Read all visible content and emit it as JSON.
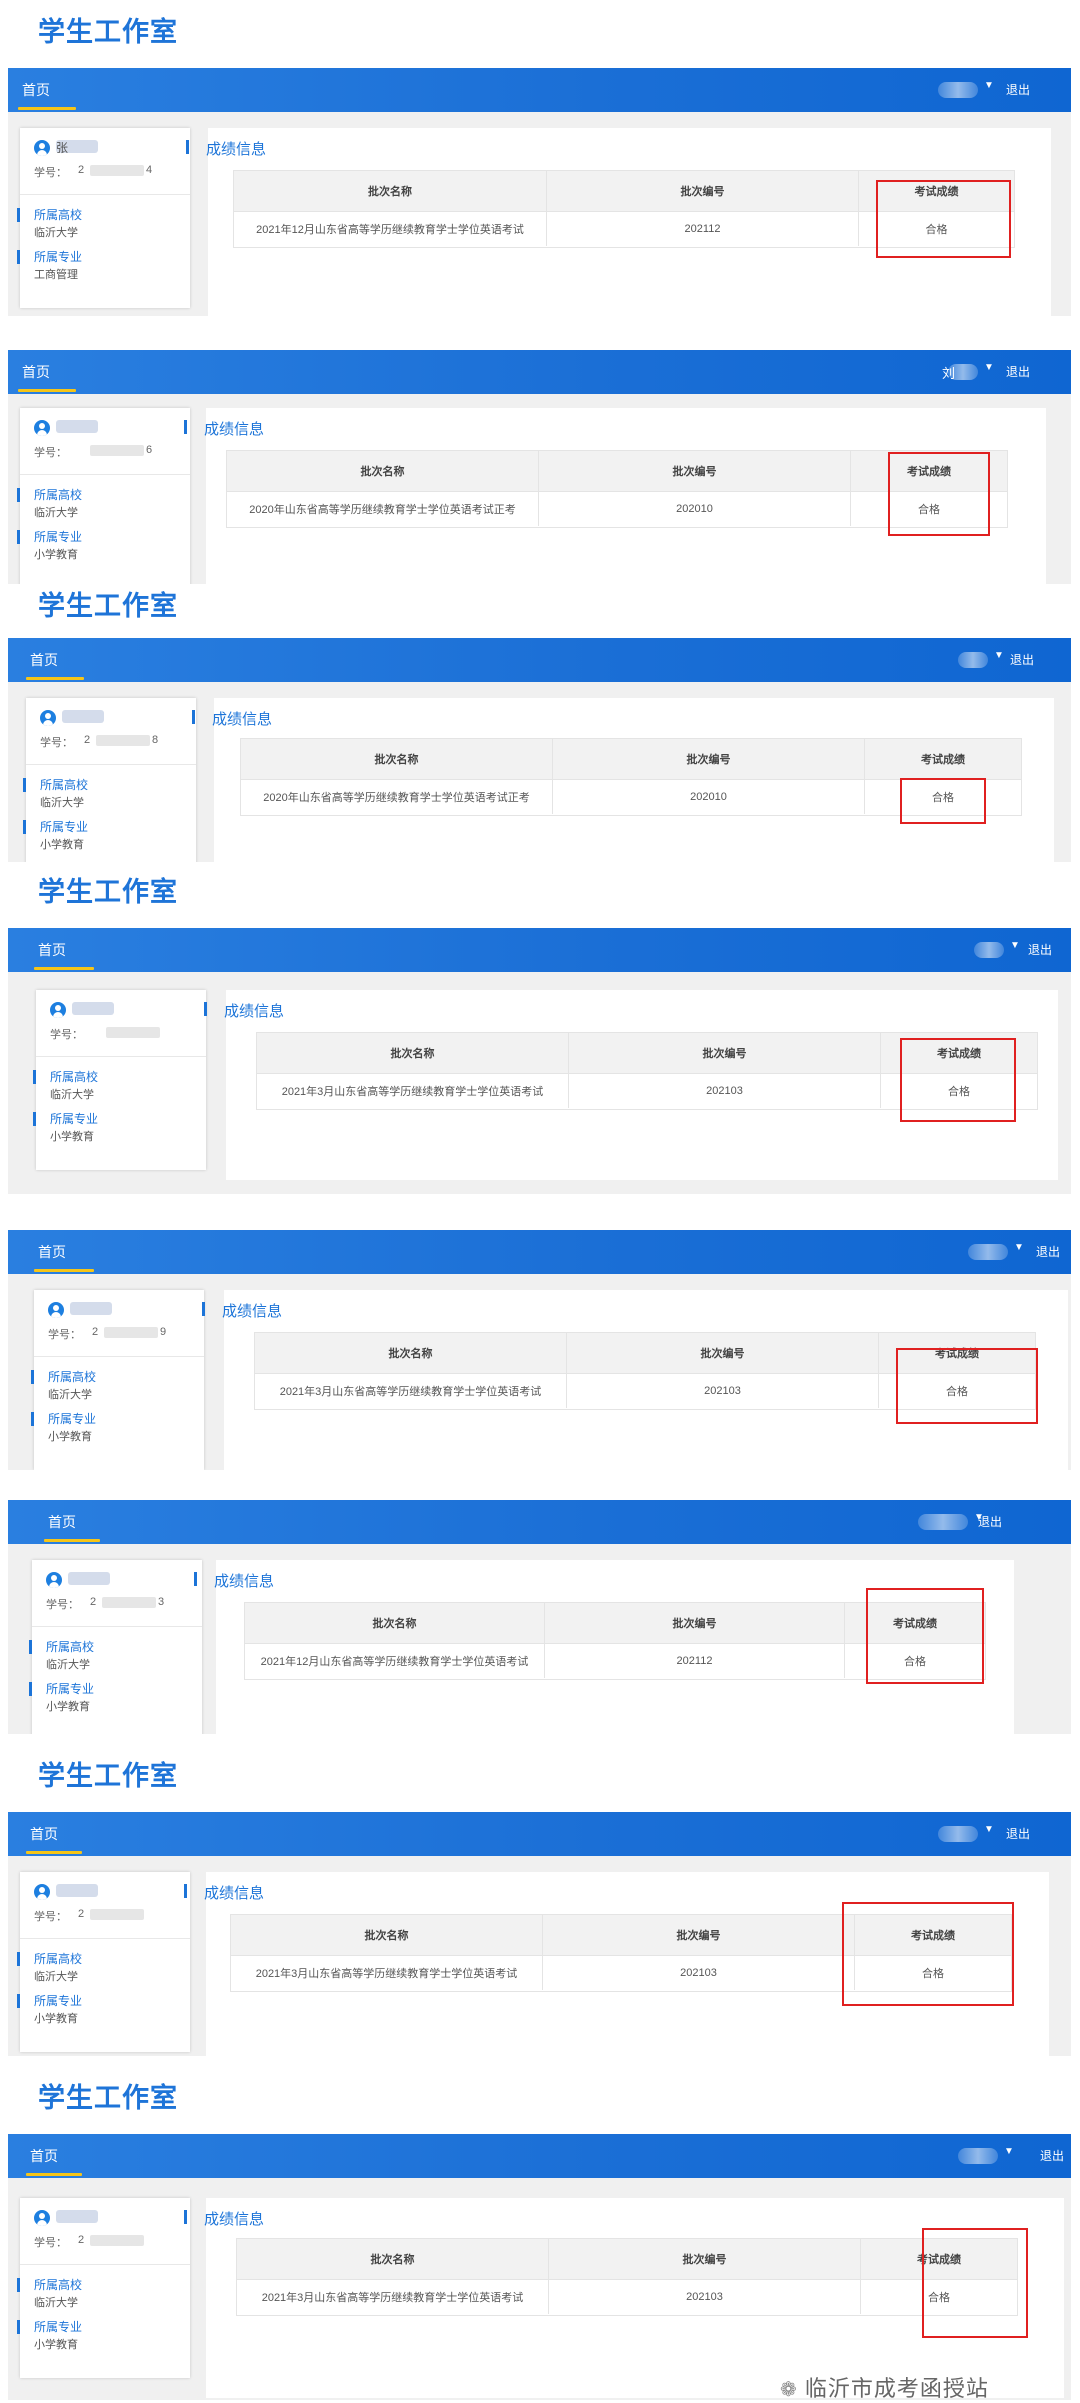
{
  "watermark": "学生工作室",
  "footer": {
    "text": "临沂市成考函授站",
    "icon": "wechat-icon"
  },
  "colors": {
    "topbar": "#1b6fd6",
    "accent": "#1c74d8",
    "highlight_box": "#e02020",
    "nav_underline": "#f5c518"
  },
  "common": {
    "nav_home": "首页",
    "logout": "退出",
    "section_title": "成绩信息",
    "student_no_label": "学号：",
    "school_label": "所属高校",
    "major_label": "所属专业",
    "col_batch_name": "批次名称",
    "col_batch_no": "批次编号",
    "col_score": "考试成绩"
  },
  "records": [
    {
      "name_char": "张",
      "user_char": "",
      "id_prefix": "2",
      "id_suffix": "4",
      "school": "临沂大学",
      "major": "工商管理",
      "batch_name": "2021年12月山东省高等学历继续教育学士学位英语考试",
      "batch_no": "202112",
      "score": "合格"
    },
    {
      "name_char": "",
      "user_char": "刘",
      "id_prefix": "",
      "id_suffix": "6",
      "school": "临沂大学",
      "major": "小学教育",
      "batch_name": "2020年山东省高等学历继续教育学士学位英语考试正考",
      "batch_no": "202010",
      "score": "合格"
    },
    {
      "name_char": "",
      "user_char": "",
      "id_prefix": "2",
      "id_suffix": "8",
      "school": "临沂大学",
      "major": "小学教育",
      "batch_name": "2020年山东省高等学历继续教育学士学位英语考试正考",
      "batch_no": "202010",
      "score": "合格"
    },
    {
      "name_char": "",
      "user_char": "",
      "id_prefix": "",
      "id_suffix": "",
      "school": "临沂大学",
      "major": "小学教育",
      "batch_name": "2021年3月山东省高等学历继续教育学士学位英语考试",
      "batch_no": "202103",
      "score": "合格"
    },
    {
      "name_char": "",
      "user_char": "",
      "id_prefix": "2",
      "id_suffix": "9",
      "school": "临沂大学",
      "major": "小学教育",
      "batch_name": "2021年3月山东省高等学历继续教育学士学位英语考试",
      "batch_no": "202103",
      "score": "合格"
    },
    {
      "name_char": "",
      "user_char": "",
      "id_prefix": "2",
      "id_suffix": "3",
      "school": "临沂大学",
      "major": "小学教育",
      "batch_name": "2021年12月山东省高等学历继续教育学士学位英语考试",
      "batch_no": "202112",
      "score": "合格"
    },
    {
      "name_char": "",
      "user_char": "",
      "id_prefix": "2",
      "id_suffix": "",
      "school": "临沂大学",
      "major": "小学教育",
      "batch_name": "2021年3月山东省高等学历继续教育学士学位英语考试",
      "batch_no": "202103",
      "score": "合格"
    },
    {
      "name_char": "",
      "user_char": "",
      "id_prefix": "2",
      "id_suffix": "",
      "school": "临沂大学",
      "major": "小学教育",
      "batch_name": "2021年3月山东省高等学历继续教育学士学位英语考试",
      "batch_no": "202103",
      "score": "合格"
    }
  ]
}
